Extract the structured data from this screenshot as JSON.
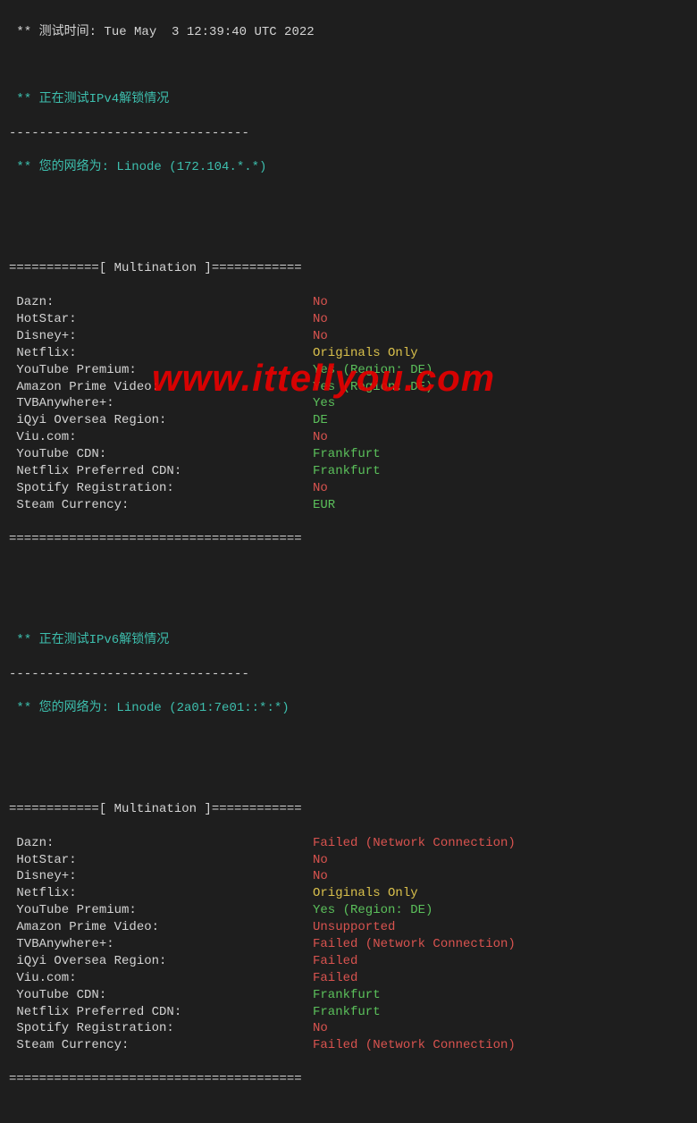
{
  "header": {
    "test_time_label": " ** 测试时间: ",
    "test_time_value": "Tue May  3 12:39:40 UTC 2022"
  },
  "ipv4": {
    "testing_line": " ** 正在测试IPv4解锁情况 ",
    "dash_short": "--------------------------------",
    "network_prefix": " ** 您的网络为: ",
    "network_value": "Linode (172.104.*.*)",
    "section_header": "============[ Multination ]============",
    "items": [
      {
        "label": " Dazn:",
        "value": "No",
        "cls": "red"
      },
      {
        "label": " HotStar:",
        "value": "No",
        "cls": "red"
      },
      {
        "label": " Disney+:",
        "value": "No",
        "cls": "red"
      },
      {
        "label": " Netflix:",
        "value": "Originals Only",
        "cls": "yellow"
      },
      {
        "label": " YouTube Premium:",
        "value": "Yes (Region: DE)",
        "cls": "green"
      },
      {
        "label": " Amazon Prime Video:",
        "value": "Yes (Region: DE)",
        "cls": "green"
      },
      {
        "label": " TVBAnywhere+:",
        "value": "Yes",
        "cls": "green"
      },
      {
        "label": " iQyi Oversea Region:",
        "value": "DE",
        "cls": "green"
      },
      {
        "label": " Viu.com:",
        "value": "No",
        "cls": "red"
      },
      {
        "label": " YouTube CDN:",
        "value": "Frankfurt",
        "cls": "green"
      },
      {
        "label": " Netflix Preferred CDN:",
        "value": "Frankfurt",
        "cls": "green"
      },
      {
        "label": " Spotify Registration:",
        "value": "No",
        "cls": "red"
      },
      {
        "label": " Steam Currency:",
        "value": "EUR",
        "cls": "green"
      }
    ],
    "section_footer": "======================================="
  },
  "ipv6": {
    "testing_line": " ** 正在测试IPv6解锁情况 ",
    "dash_short": "--------------------------------",
    "network_prefix": " ** 您的网络为: ",
    "network_value": "Linode (2a01:7e01::*:*)",
    "section_header": "============[ Multination ]============",
    "items": [
      {
        "label": " Dazn:",
        "value": "Failed (Network Connection)",
        "cls": "red"
      },
      {
        "label": " HotStar:",
        "value": "No",
        "cls": "red"
      },
      {
        "label": " Disney+:",
        "value": "No",
        "cls": "red"
      },
      {
        "label": " Netflix:",
        "value": "Originals Only",
        "cls": "yellow"
      },
      {
        "label": " YouTube Premium:",
        "value": "Yes (Region: DE)",
        "cls": "green"
      },
      {
        "label": " Amazon Prime Video:",
        "value": "Unsupported",
        "cls": "red"
      },
      {
        "label": " TVBAnywhere+:",
        "value": "Failed (Network Connection)",
        "cls": "red"
      },
      {
        "label": " iQyi Oversea Region:",
        "value": "Failed",
        "cls": "red"
      },
      {
        "label": " Viu.com:",
        "value": "Failed",
        "cls": "red"
      },
      {
        "label": " YouTube CDN:",
        "value": "Frankfurt",
        "cls": "green"
      },
      {
        "label": " Netflix Preferred CDN:",
        "value": "Frankfurt",
        "cls": "green"
      },
      {
        "label": " Spotify Registration:",
        "value": "No",
        "cls": "red"
      },
      {
        "label": " Steam Currency:",
        "value": "Failed (Network Connection)",
        "cls": "red"
      }
    ],
    "section_footer": "======================================="
  },
  "watermark": "www.ittellyou.com"
}
